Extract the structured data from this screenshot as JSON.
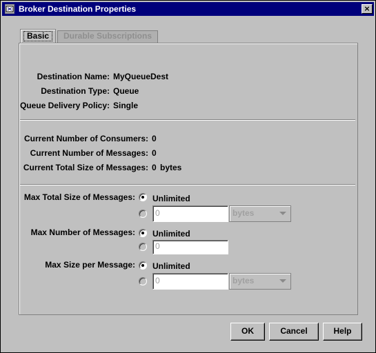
{
  "window": {
    "title": "Broker Destination Properties",
    "close_glyph": "×"
  },
  "tabs": [
    {
      "label": "Basic",
      "active": true
    },
    {
      "label": "Durable Subscriptions",
      "active": false
    }
  ],
  "destination": {
    "name_label": "Destination Name:",
    "name_value": "MyQueueDest",
    "type_label": "Destination Type:",
    "type_value": "Queue",
    "policy_label": "Queue Delivery Policy:",
    "policy_value": "Single"
  },
  "stats": {
    "consumers_label": "Current Number of Consumers:",
    "consumers_value": "0",
    "messages_label": "Current Number of Messages:",
    "messages_value": "0",
    "total_size_label": "Current Total Size of Messages:",
    "total_size_value": "0",
    "total_size_unit": "bytes"
  },
  "limits": {
    "max_total_size": {
      "label": "Max Total Size of Messages:",
      "unlimited_label": "Unlimited",
      "value": "0",
      "unit": "bytes"
    },
    "max_messages": {
      "label": "Max Number of Messages:",
      "unlimited_label": "Unlimited",
      "value": "0"
    },
    "max_size_per_message": {
      "label": "Max Size per Message:",
      "unlimited_label": "Unlimited",
      "value": "0",
      "unit": "bytes"
    }
  },
  "buttons": {
    "ok": "OK",
    "cancel": "Cancel",
    "help": "Help"
  }
}
